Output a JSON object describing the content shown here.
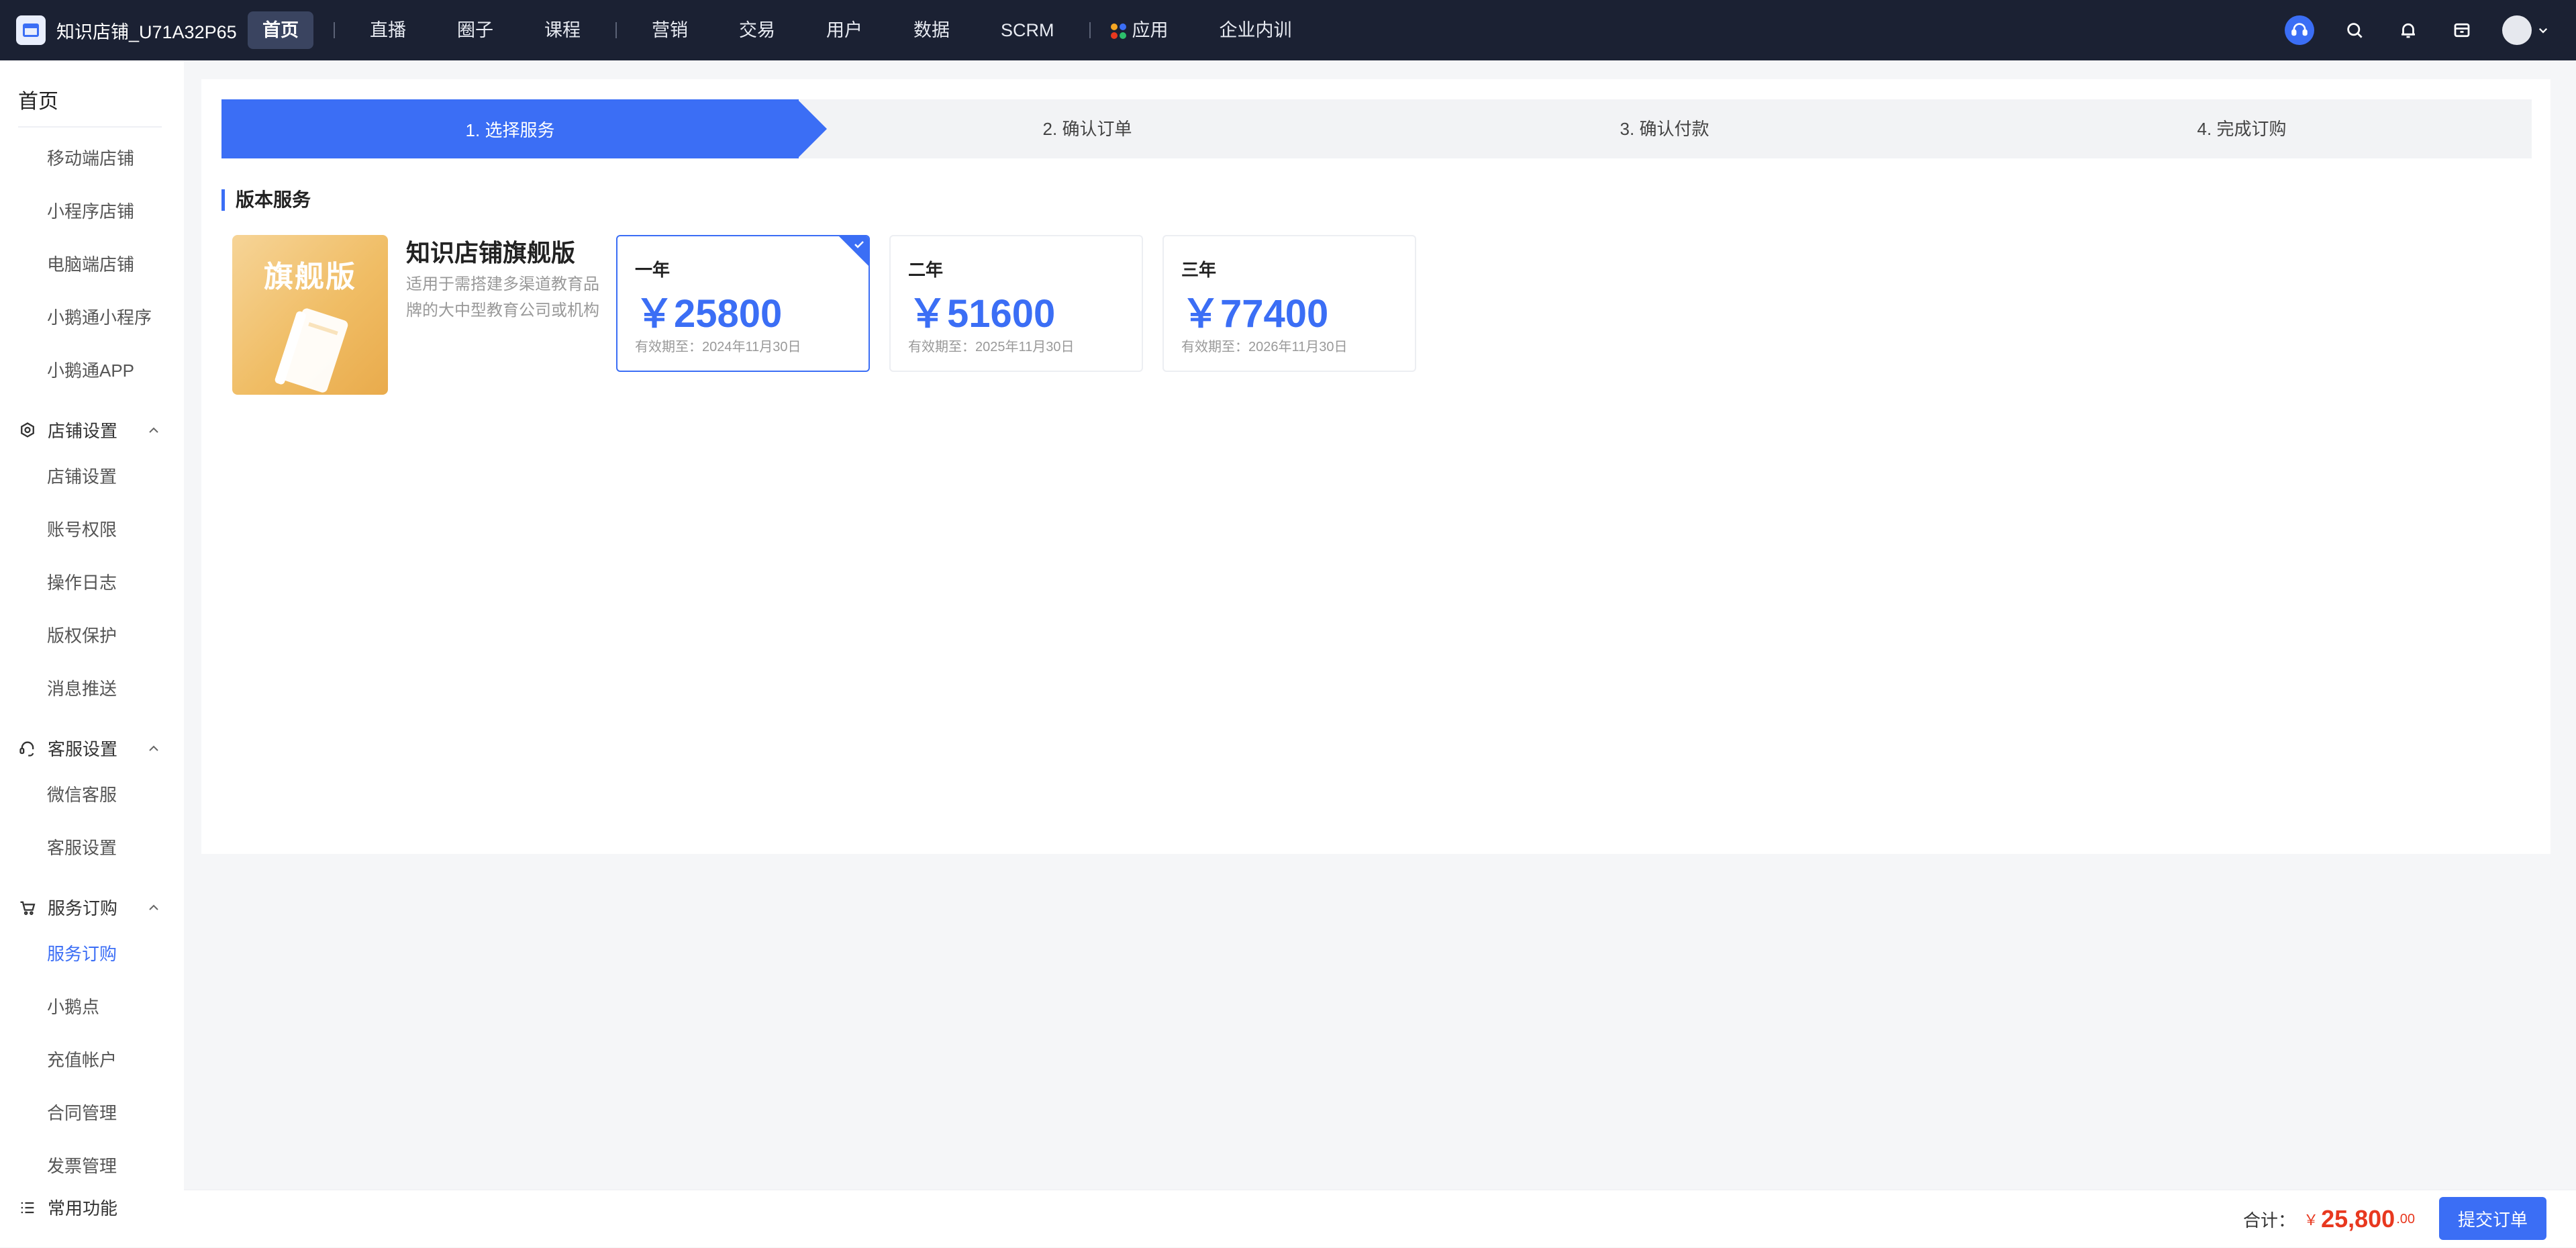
{
  "topbar": {
    "brand_name": "知识店铺_U71A32P65",
    "nav": [
      "首页",
      "直播",
      "圈子",
      "课程",
      "营销",
      "交易",
      "用户",
      "数据",
      "SCRM",
      "应用",
      "企业内训"
    ]
  },
  "sidebar": {
    "home": "首页",
    "top_items": [
      "移动端店铺",
      "小程序店铺",
      "电脑端店铺",
      "小鹅通小程序",
      "小鹅通APP"
    ],
    "groups": [
      {
        "label": "店铺设置",
        "icon": "settings-icon",
        "items": [
          "店铺设置",
          "账号权限",
          "操作日志",
          "版权保护",
          "消息推送"
        ]
      },
      {
        "label": "客服设置",
        "icon": "headset-icon",
        "items": [
          "微信客服",
          "客服设置"
        ]
      },
      {
        "label": "服务订购",
        "icon": "cart-icon",
        "items": [
          "服务订购",
          "小鹅点",
          "充值帐户",
          "合同管理",
          "发票管理"
        ]
      }
    ],
    "active_item": "服务订购",
    "bottom": "常用功能"
  },
  "steps": [
    "1. 选择服务",
    "2. 确认订单",
    "3. 确认付款",
    "4. 完成订购"
  ],
  "section_title": "版本服务",
  "product": {
    "badge": "旗舰版",
    "name": "知识店铺旗舰版",
    "description": "适用于需搭建多渠道教育品牌的大中型教育公司或机构"
  },
  "plans": [
    {
      "period": "一年",
      "price": "￥25800",
      "valid": "有效期至：2024年11月30日",
      "selected": true
    },
    {
      "period": "二年",
      "price": "￥51600",
      "valid": "有效期至：2025年11月30日",
      "selected": false
    },
    {
      "period": "三年",
      "price": "￥77400",
      "valid": "有效期至：2026年11月30日",
      "selected": false
    }
  ],
  "footer": {
    "total_label": "合计：",
    "currency": "￥",
    "amount": "25,800",
    "cents": ".00",
    "submit": "提交订单"
  },
  "colors": {
    "accent": "#3b6ef5",
    "topbar": "#1b2133",
    "total": "#e8381f",
    "badge_bg": "#f0bd65"
  }
}
